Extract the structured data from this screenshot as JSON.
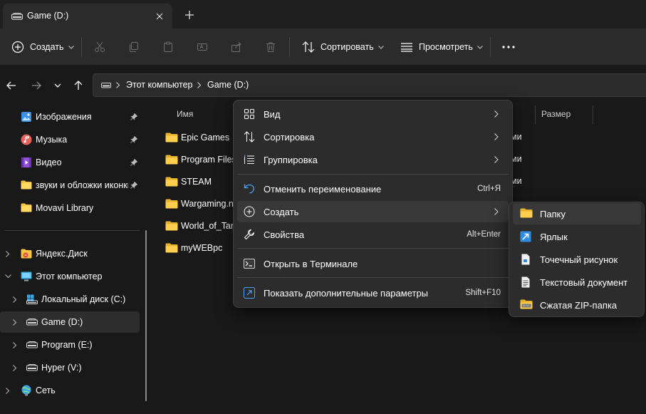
{
  "window": {
    "tab_title": "Game (D:)",
    "tab_icon": "drive-icon",
    "close_icon": "close-icon",
    "new_tab_icon": "plus-icon"
  },
  "commandbar": {
    "create_label": "Создать",
    "sort_label": "Сортировать",
    "view_label": "Просмотреть",
    "icons": [
      "cut-icon",
      "copy-icon",
      "paste-icon",
      "rename-icon",
      "share-icon",
      "delete-icon",
      "more-icon"
    ]
  },
  "address": {
    "segments": [
      "Этот компьютер",
      "Game (D:)"
    ]
  },
  "sidebar": {
    "quick_access": [
      {
        "label": "Изображения",
        "icon": "pictures-icon",
        "pinned": true
      },
      {
        "label": "Музыка",
        "icon": "music-icon",
        "pinned": true
      },
      {
        "label": "Видео",
        "icon": "video-icon",
        "pinned": true
      },
      {
        "label": "звуки и обложки иконки",
        "icon": "folder-icon",
        "pinned": true
      },
      {
        "label": "Movavi Library",
        "icon": "folder-icon",
        "pinned": false
      }
    ],
    "tree": [
      {
        "label": "Яндекс.Диск",
        "icon": "yandex-disk-icon",
        "expanded": false
      },
      {
        "label": "Этот компьютер",
        "icon": "computer-icon",
        "expanded": true
      },
      {
        "label": "Локальный диск (C:)",
        "icon": "windows-drive-icon",
        "expanded": false
      },
      {
        "label": "Game (D:)",
        "icon": "drive-icon",
        "expanded": false,
        "selected": true
      },
      {
        "label": "Program (E:)",
        "icon": "drive-icon",
        "expanded": false
      },
      {
        "label": "Hyper (V:)",
        "icon": "drive-icon",
        "expanded": false
      },
      {
        "label": "Сеть",
        "icon": "network-icon",
        "expanded": false
      }
    ]
  },
  "filelist": {
    "columns": {
      "name": "Имя",
      "size": "Размер"
    },
    "rows": [
      {
        "name": "Epic Games"
      },
      {
        "name": "Program Files"
      },
      {
        "name": "STEAM"
      },
      {
        "name": "Wargaming.net"
      },
      {
        "name": "World_of_Tanks"
      },
      {
        "name": "myWEBpc"
      }
    ],
    "partial_type_text": [
      "ми",
      "ми",
      "ми"
    ]
  },
  "context_menu": {
    "items": [
      {
        "label": "Вид",
        "icon": "view-grid-icon",
        "submenu": true
      },
      {
        "label": "Сортировка",
        "icon": "sort-icon",
        "submenu": true
      },
      {
        "label": "Группировка",
        "icon": "group-icon",
        "submenu": true
      },
      {
        "label": "Отменить переименование",
        "icon": "undo-icon",
        "shortcut": "Ctrl+Я"
      },
      {
        "label": "Создать",
        "icon": "new-icon",
        "submenu": true,
        "highlighted": true
      },
      {
        "label": "Свойства",
        "icon": "properties-icon",
        "shortcut": "Alt+Enter"
      },
      {
        "label": "Открыть в Терминале",
        "icon": "terminal-icon"
      },
      {
        "label": "Показать дополнительные параметры",
        "icon": "more-options-icon",
        "shortcut": "Shift+F10"
      }
    ]
  },
  "submenu_new": {
    "items": [
      {
        "label": "Папку",
        "icon": "folder-icon",
        "highlighted": true
      },
      {
        "label": "Ярлык",
        "icon": "shortcut-icon"
      },
      {
        "label": "Точечный рисунок",
        "icon": "bitmap-icon"
      },
      {
        "label": "Текстовый документ",
        "icon": "text-document-icon"
      },
      {
        "label": "Сжатая ZIP-папка",
        "icon": "zip-folder-icon"
      }
    ]
  },
  "colors": {
    "background": "#191919",
    "panel": "#2b2b2b",
    "menu": "#2c2c2c",
    "menu_highlight": "#383838",
    "folder_yellow": "#f5c443",
    "accent_blue": "#4aa3ff"
  }
}
